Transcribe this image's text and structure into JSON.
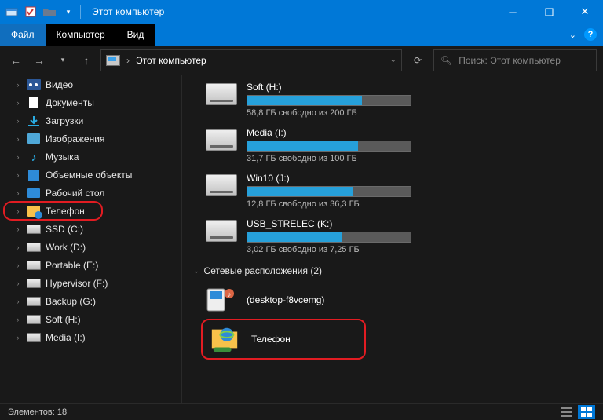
{
  "titlebar": {
    "title": "Этот компьютер"
  },
  "ribbon": {
    "file": "Файл",
    "computer": "Компьютер",
    "view": "Вид"
  },
  "nav": {
    "breadcrumb_sep": "›",
    "breadcrumb": "Этот компьютер",
    "search_placeholder": "Поиск: Этот компьютер"
  },
  "sidebar": {
    "items": [
      {
        "label": "Видео",
        "icon": "video"
      },
      {
        "label": "Документы",
        "icon": "doc"
      },
      {
        "label": "Загрузки",
        "icon": "down"
      },
      {
        "label": "Изображения",
        "icon": "pic"
      },
      {
        "label": "Музыка",
        "icon": "music"
      },
      {
        "label": "Объемные объекты",
        "icon": "3d"
      },
      {
        "label": "Рабочий стол",
        "icon": "desk"
      },
      {
        "label": "Телефон",
        "icon": "phone",
        "highlight": true
      },
      {
        "label": "SSD (C:)",
        "icon": "drive"
      },
      {
        "label": "Work (D:)",
        "icon": "drive"
      },
      {
        "label": "Portable (E:)",
        "icon": "drive"
      },
      {
        "label": "Hypervisor (F:)",
        "icon": "drive"
      },
      {
        "label": "Backup (G:)",
        "icon": "drive"
      },
      {
        "label": "Soft (H:)",
        "icon": "drive"
      },
      {
        "label": "Media (I:)",
        "icon": "drive"
      }
    ]
  },
  "drives": [
    {
      "name": "Soft (H:)",
      "text": "58,8 ГБ свободно из 200 ГБ",
      "pct": 70
    },
    {
      "name": "Media (I:)",
      "text": "31,7 ГБ свободно из 100 ГБ",
      "pct": 68
    },
    {
      "name": "Win10 (J:)",
      "text": "12,8 ГБ свободно из 36,3 ГБ",
      "pct": 65
    },
    {
      "name": "USB_STRELEC (K:)",
      "text": "3,02 ГБ свободно из 7,25 ГБ",
      "pct": 58
    }
  ],
  "network": {
    "header": "Сетевые расположения (2)",
    "items": [
      {
        "label": "(desktop-f8vcemg)"
      },
      {
        "label": "Телефон",
        "highlight": true
      }
    ]
  },
  "status": {
    "elements": "Элементов: 18"
  }
}
